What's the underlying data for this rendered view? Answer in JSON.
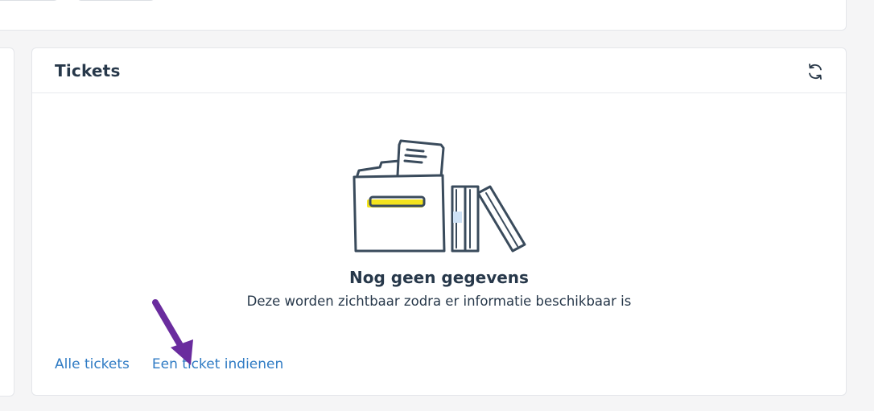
{
  "tickets": {
    "title": "Tickets",
    "refresh_icon": "refresh-icon",
    "empty_state": {
      "icon": "empty-box-with-books-illustration",
      "title": "Nog geen gegevens",
      "subtitle": "Deze worden zichtbaar zodra er informatie beschikbaar is"
    },
    "links": {
      "all_tickets": "Alle tickets",
      "submit_ticket": "Een ticket indienen"
    }
  },
  "colors": {
    "link": "#2f7bc4",
    "text": "#27384a",
    "illustration_stroke": "#3a4b5c",
    "illustration_accent": "#f4e41d",
    "annotation_arrow": "#6a2c9e"
  }
}
